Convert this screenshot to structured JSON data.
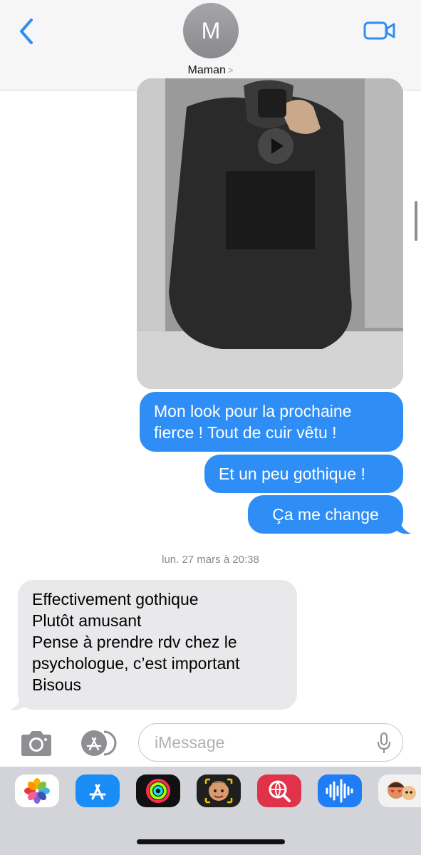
{
  "header": {
    "avatar_initial": "M",
    "contact_name": "Maman",
    "chevron": ">"
  },
  "messages": {
    "sent_1_line1": "Mon look pour la prochaine",
    "sent_1_line2": "fierce ! Tout de cuir vêtu !",
    "sent_2": "Et un peu gothique !",
    "sent_3": "Ça me change",
    "timestamp": "lun. 27 mars à 20:38",
    "received": [
      "Effectivement gothique",
      "Plutôt amusant",
      "Pense à prendre rdv chez le",
      "psychologue, c’est important",
      "Bisous"
    ]
  },
  "input": {
    "placeholder": "iMessage"
  },
  "icons": {
    "back": "chevron-left-icon",
    "video": "video-camera-icon",
    "camera": "camera-icon",
    "apps": "app-store-icon",
    "mic": "microphone-icon",
    "drawer": [
      "photos-icon",
      "app-store-icon",
      "fitness-activity-icon",
      "memoji-icon",
      "image-search-icon",
      "audio-message-icon",
      "memoji-stickers-icon"
    ]
  },
  "colors": {
    "accent": "#2f8ef5",
    "incoming": "#e9e9eb"
  }
}
